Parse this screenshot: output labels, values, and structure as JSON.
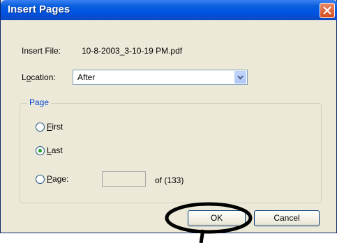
{
  "window": {
    "title": "Insert Pages",
    "close_icon": "close-icon"
  },
  "insert_file": {
    "label": "Insert File:",
    "value": "10-8-2003_3-10-19 PM.pdf"
  },
  "location": {
    "label_prefix": "L",
    "label_mnemonic": "o",
    "label_suffix": "cation:",
    "selected": "After"
  },
  "page_group": {
    "legend": "Page",
    "options": [
      {
        "mnemonic": "F",
        "rest": "irst",
        "selected": false
      },
      {
        "mnemonic": "L",
        "rest": "ast",
        "selected": true
      },
      {
        "mnemonic": "P",
        "rest": "age:",
        "selected": false
      }
    ],
    "page_value": "",
    "of_text": "of (133)"
  },
  "buttons": {
    "ok": "OK",
    "cancel": "Cancel"
  },
  "colors": {
    "titlebar": "#0054e3",
    "dialog_bg": "#ece9d8",
    "group_legend": "#0046d5",
    "close_button": "#d24a1c",
    "radio_dot": "#21a121",
    "annotation": "#000000"
  }
}
